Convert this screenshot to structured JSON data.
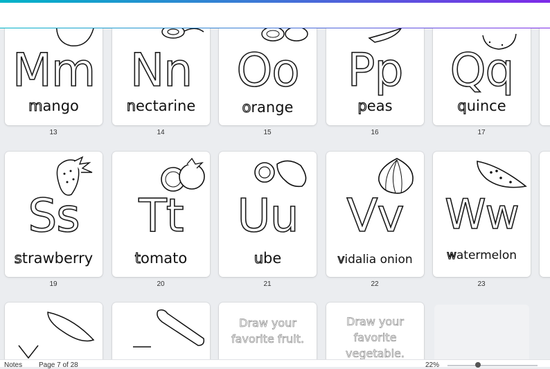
{
  "pages_row1": [
    {
      "letters": "Mm",
      "word_first": "m",
      "word_rest": "ango",
      "number": "13"
    },
    {
      "letters": "Nn",
      "word_first": "n",
      "word_rest": "ectarine",
      "number": "14"
    },
    {
      "letters": "Oo",
      "word_first": "o",
      "word_rest": "range",
      "number": "15"
    },
    {
      "letters": "Pp",
      "word_first": "p",
      "word_rest": "eas",
      "number": "16"
    },
    {
      "letters": "Qq",
      "word_first": "q",
      "word_rest": "uince",
      "number": "17"
    }
  ],
  "pages_row2": [
    {
      "letters": "Ss",
      "word_first": "s",
      "word_rest": "trawberry",
      "number": "19"
    },
    {
      "letters": "Tt",
      "word_first": "t",
      "word_rest": "omato",
      "number": "20"
    },
    {
      "letters": "Uu",
      "word_first": "u",
      "word_rest": "be",
      "number": "21"
    },
    {
      "letters": "Vv",
      "word_first": "v",
      "word_rest": "idalia onion",
      "number": "22"
    },
    {
      "letters": "Ww",
      "word_first": "w",
      "word_rest": "atermelon",
      "number": "23"
    }
  ],
  "pages_row3": {
    "prompt_fruit": "Draw your favorite fruit.",
    "prompt_vegetable": "Draw your favorite vegetable."
  },
  "bottom_bar": {
    "notes_label": "Notes",
    "page_indicator": "Page 7 of 28",
    "zoom": "22%"
  },
  "colors": {
    "accent_gradient_start": "#00b4c8",
    "accent_gradient_end": "#7d2ae8"
  }
}
